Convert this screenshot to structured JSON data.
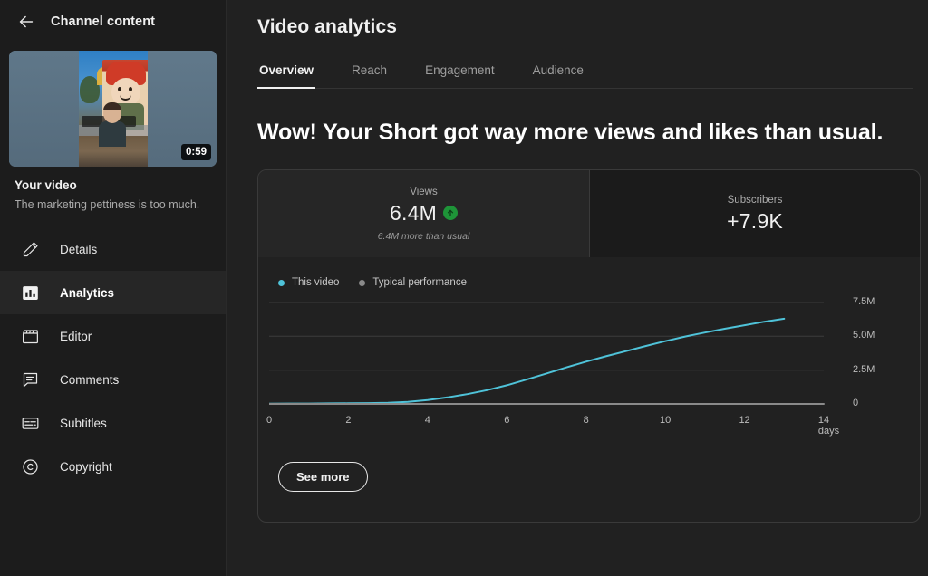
{
  "sidebar": {
    "back_label": "Channel content",
    "back_icon": "back-arrow-icon",
    "video": {
      "duration": "0:59",
      "title": "Your video",
      "description": "The marketing pettiness is too much."
    },
    "items": [
      {
        "label": "Details",
        "icon": "pencil-icon",
        "active": false
      },
      {
        "label": "Analytics",
        "icon": "bar-chart-icon",
        "active": true
      },
      {
        "label": "Editor",
        "icon": "clapperboard-icon",
        "active": false
      },
      {
        "label": "Comments",
        "icon": "comment-icon",
        "active": false
      },
      {
        "label": "Subtitles",
        "icon": "subtitles-icon",
        "active": false
      },
      {
        "label": "Copyright",
        "icon": "copyright-icon",
        "active": false
      }
    ]
  },
  "main": {
    "page_title": "Video analytics",
    "tabs": [
      {
        "label": "Overview",
        "active": true
      },
      {
        "label": "Reach",
        "active": false
      },
      {
        "label": "Engagement",
        "active": false
      },
      {
        "label": "Audience",
        "active": false
      }
    ],
    "headline": "Wow! Your Short got way more views and likes than usual.",
    "stats": [
      {
        "label": "Views",
        "value": "6.4M",
        "trend_icon": "arrow-up-icon",
        "sub": "6.4M more than usual"
      },
      {
        "label": "Subscribers",
        "value": "+7.9K",
        "trend_icon": "",
        "sub": ""
      }
    ],
    "see_more_label": "See more"
  },
  "colors": {
    "accent_line": "#3ea6c8",
    "legend_this_video": "#4fc3d9",
    "legend_typical": "#8a8a8a",
    "trend_green": "#1e9438",
    "sidebar_bg": "#1c1c1c",
    "main_bg": "#212121",
    "card_border": "#3a3a3a"
  },
  "chart_data": {
    "type": "line",
    "title": "",
    "xlabel": "",
    "ylabel": "",
    "legend": [
      {
        "name": "This video",
        "color": "#4fc3d9"
      },
      {
        "name": "Typical performance",
        "color": "#8a8a8a"
      }
    ],
    "legend_position": "top-left",
    "grid": true,
    "xlim": [
      0,
      14
    ],
    "ylim": [
      0,
      7500000
    ],
    "xticks": [
      0,
      2,
      4,
      6,
      8,
      10,
      12,
      14
    ],
    "xtick_labels": [
      "0",
      "2",
      "4",
      "6",
      "8",
      "10",
      "12",
      "14 days"
    ],
    "yticks": [
      0,
      2500000,
      5000000,
      7500000
    ],
    "ytick_labels": [
      "0",
      "2.5M",
      "5.0M",
      "7.5M"
    ],
    "series": [
      {
        "name": "This video",
        "color": "#4fc3d9",
        "x": [
          0,
          0.5,
          1,
          1.5,
          2,
          2.5,
          3,
          3.5,
          4,
          4.5,
          5,
          5.5,
          6,
          6.5,
          7,
          7.5,
          8,
          8.5,
          9,
          9.5,
          10,
          10.5,
          11,
          11.5,
          12,
          12.5,
          13
        ],
        "values": [
          20000,
          25000,
          30000,
          38000,
          45000,
          60000,
          90000,
          150000,
          290000,
          480000,
          720000,
          1020000,
          1380000,
          1800000,
          2250000,
          2700000,
          3130000,
          3520000,
          3900000,
          4280000,
          4640000,
          4980000,
          5280000,
          5560000,
          5820000,
          6080000,
          6300000
        ]
      },
      {
        "name": "Typical performance",
        "color": "#8a8a8a",
        "x": [
          0,
          2,
          4,
          6,
          8,
          10,
          12,
          14
        ],
        "values": [
          0,
          0,
          0,
          0,
          0,
          0,
          0,
          0
        ]
      }
    ]
  }
}
